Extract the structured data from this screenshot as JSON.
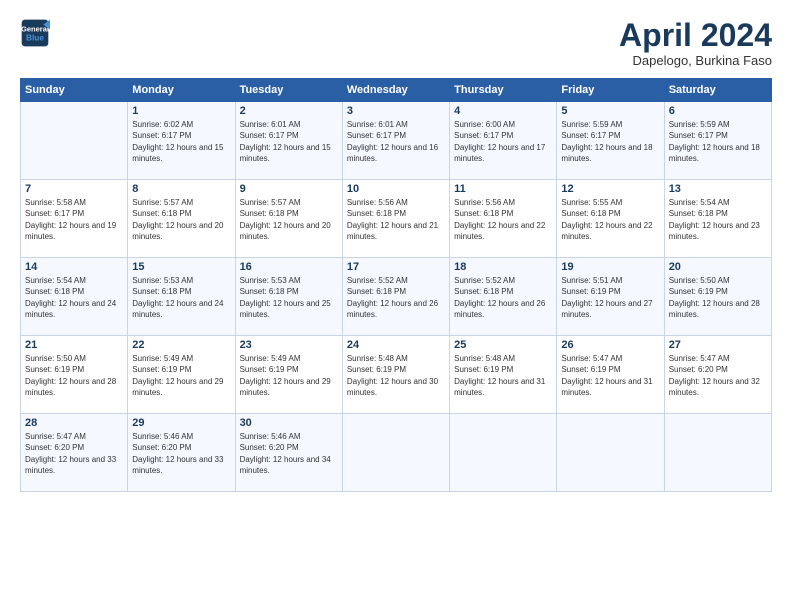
{
  "header": {
    "logo_line1": "General",
    "logo_line2": "Blue",
    "month_title": "April 2024",
    "location": "Dapelogo, Burkina Faso"
  },
  "weekdays": [
    "Sunday",
    "Monday",
    "Tuesday",
    "Wednesday",
    "Thursday",
    "Friday",
    "Saturday"
  ],
  "weeks": [
    [
      {
        "day": "",
        "sunrise": "",
        "sunset": "",
        "daylight": ""
      },
      {
        "day": "1",
        "sunrise": "Sunrise: 6:02 AM",
        "sunset": "Sunset: 6:17 PM",
        "daylight": "Daylight: 12 hours and 15 minutes."
      },
      {
        "day": "2",
        "sunrise": "Sunrise: 6:01 AM",
        "sunset": "Sunset: 6:17 PM",
        "daylight": "Daylight: 12 hours and 15 minutes."
      },
      {
        "day": "3",
        "sunrise": "Sunrise: 6:01 AM",
        "sunset": "Sunset: 6:17 PM",
        "daylight": "Daylight: 12 hours and 16 minutes."
      },
      {
        "day": "4",
        "sunrise": "Sunrise: 6:00 AM",
        "sunset": "Sunset: 6:17 PM",
        "daylight": "Daylight: 12 hours and 17 minutes."
      },
      {
        "day": "5",
        "sunrise": "Sunrise: 5:59 AM",
        "sunset": "Sunset: 6:17 PM",
        "daylight": "Daylight: 12 hours and 18 minutes."
      },
      {
        "day": "6",
        "sunrise": "Sunrise: 5:59 AM",
        "sunset": "Sunset: 6:17 PM",
        "daylight": "Daylight: 12 hours and 18 minutes."
      }
    ],
    [
      {
        "day": "7",
        "sunrise": "Sunrise: 5:58 AM",
        "sunset": "Sunset: 6:17 PM",
        "daylight": "Daylight: 12 hours and 19 minutes."
      },
      {
        "day": "8",
        "sunrise": "Sunrise: 5:57 AM",
        "sunset": "Sunset: 6:18 PM",
        "daylight": "Daylight: 12 hours and 20 minutes."
      },
      {
        "day": "9",
        "sunrise": "Sunrise: 5:57 AM",
        "sunset": "Sunset: 6:18 PM",
        "daylight": "Daylight: 12 hours and 20 minutes."
      },
      {
        "day": "10",
        "sunrise": "Sunrise: 5:56 AM",
        "sunset": "Sunset: 6:18 PM",
        "daylight": "Daylight: 12 hours and 21 minutes."
      },
      {
        "day": "11",
        "sunrise": "Sunrise: 5:56 AM",
        "sunset": "Sunset: 6:18 PM",
        "daylight": "Daylight: 12 hours and 22 minutes."
      },
      {
        "day": "12",
        "sunrise": "Sunrise: 5:55 AM",
        "sunset": "Sunset: 6:18 PM",
        "daylight": "Daylight: 12 hours and 22 minutes."
      },
      {
        "day": "13",
        "sunrise": "Sunrise: 5:54 AM",
        "sunset": "Sunset: 6:18 PM",
        "daylight": "Daylight: 12 hours and 23 minutes."
      }
    ],
    [
      {
        "day": "14",
        "sunrise": "Sunrise: 5:54 AM",
        "sunset": "Sunset: 6:18 PM",
        "daylight": "Daylight: 12 hours and 24 minutes."
      },
      {
        "day": "15",
        "sunrise": "Sunrise: 5:53 AM",
        "sunset": "Sunset: 6:18 PM",
        "daylight": "Daylight: 12 hours and 24 minutes."
      },
      {
        "day": "16",
        "sunrise": "Sunrise: 5:53 AM",
        "sunset": "Sunset: 6:18 PM",
        "daylight": "Daylight: 12 hours and 25 minutes."
      },
      {
        "day": "17",
        "sunrise": "Sunrise: 5:52 AM",
        "sunset": "Sunset: 6:18 PM",
        "daylight": "Daylight: 12 hours and 26 minutes."
      },
      {
        "day": "18",
        "sunrise": "Sunrise: 5:52 AM",
        "sunset": "Sunset: 6:18 PM",
        "daylight": "Daylight: 12 hours and 26 minutes."
      },
      {
        "day": "19",
        "sunrise": "Sunrise: 5:51 AM",
        "sunset": "Sunset: 6:19 PM",
        "daylight": "Daylight: 12 hours and 27 minutes."
      },
      {
        "day": "20",
        "sunrise": "Sunrise: 5:50 AM",
        "sunset": "Sunset: 6:19 PM",
        "daylight": "Daylight: 12 hours and 28 minutes."
      }
    ],
    [
      {
        "day": "21",
        "sunrise": "Sunrise: 5:50 AM",
        "sunset": "Sunset: 6:19 PM",
        "daylight": "Daylight: 12 hours and 28 minutes."
      },
      {
        "day": "22",
        "sunrise": "Sunrise: 5:49 AM",
        "sunset": "Sunset: 6:19 PM",
        "daylight": "Daylight: 12 hours and 29 minutes."
      },
      {
        "day": "23",
        "sunrise": "Sunrise: 5:49 AM",
        "sunset": "Sunset: 6:19 PM",
        "daylight": "Daylight: 12 hours and 29 minutes."
      },
      {
        "day": "24",
        "sunrise": "Sunrise: 5:48 AM",
        "sunset": "Sunset: 6:19 PM",
        "daylight": "Daylight: 12 hours and 30 minutes."
      },
      {
        "day": "25",
        "sunrise": "Sunrise: 5:48 AM",
        "sunset": "Sunset: 6:19 PM",
        "daylight": "Daylight: 12 hours and 31 minutes."
      },
      {
        "day": "26",
        "sunrise": "Sunrise: 5:47 AM",
        "sunset": "Sunset: 6:19 PM",
        "daylight": "Daylight: 12 hours and 31 minutes."
      },
      {
        "day": "27",
        "sunrise": "Sunrise: 5:47 AM",
        "sunset": "Sunset: 6:20 PM",
        "daylight": "Daylight: 12 hours and 32 minutes."
      }
    ],
    [
      {
        "day": "28",
        "sunrise": "Sunrise: 5:47 AM",
        "sunset": "Sunset: 6:20 PM",
        "daylight": "Daylight: 12 hours and 33 minutes."
      },
      {
        "day": "29",
        "sunrise": "Sunrise: 5:46 AM",
        "sunset": "Sunset: 6:20 PM",
        "daylight": "Daylight: 12 hours and 33 minutes."
      },
      {
        "day": "30",
        "sunrise": "Sunrise: 5:46 AM",
        "sunset": "Sunset: 6:20 PM",
        "daylight": "Daylight: 12 hours and 34 minutes."
      },
      {
        "day": "",
        "sunrise": "",
        "sunset": "",
        "daylight": ""
      },
      {
        "day": "",
        "sunrise": "",
        "sunset": "",
        "daylight": ""
      },
      {
        "day": "",
        "sunrise": "",
        "sunset": "",
        "daylight": ""
      },
      {
        "day": "",
        "sunrise": "",
        "sunset": "",
        "daylight": ""
      }
    ]
  ]
}
